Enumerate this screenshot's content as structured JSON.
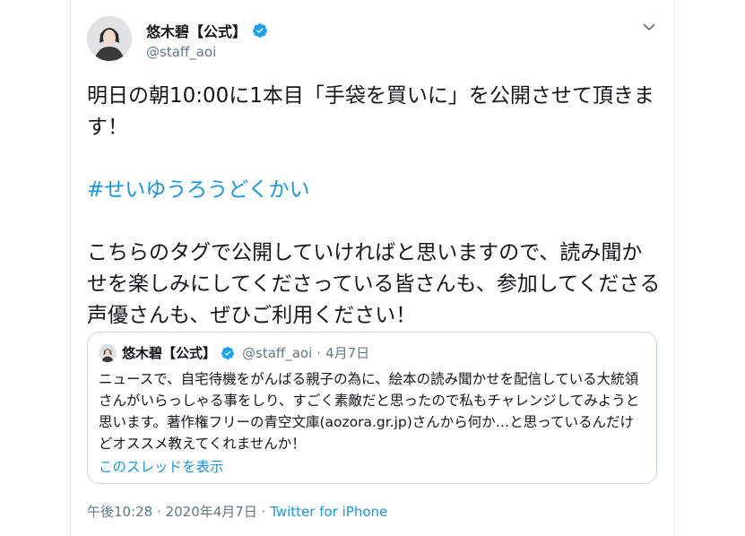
{
  "tweet": {
    "author_name": "悠木碧【公式】",
    "handle": "@staff_aoi",
    "text_part1": "明日の朝10:00に1本目「手袋を買いに」を公開させて頂きます！",
    "hashtag": "#せいゆうろうどくかい",
    "text_part2": "こちらのタグで公開していければと思いますので、読み聞かせを楽しみにしてくださっている皆さんも、参加してくださる声優さんも、ぜひご利用ください！",
    "time": "午後10:28",
    "date": "2020年4月7日",
    "separator": "·",
    "source": "Twitter for iPhone"
  },
  "quoted": {
    "author_name": "悠木碧【公式】",
    "handle": "@staff_aoi",
    "separator": "·",
    "date": "4月7日",
    "text": "ニュースで、自宅待機をがんばる親子の為に、絵本の読み聞かせを配信している大統領さんがいらっしゃる事をしり、すごく素敵だと思ったので私もチャレンジしてみようと思います。著作権フリーの青空文庫(aozora.gr.jp)さんから何か…と思っているんだけどオススメ教えてくれませんか！",
    "thread_link": "このスレッドを表示"
  },
  "colors": {
    "accent": "#1b95e0",
    "secondary_text": "#657786",
    "border": "#ccd6dd"
  },
  "icons": [
    "verified-badge-icon",
    "chevron-down-icon",
    "avatar"
  ]
}
